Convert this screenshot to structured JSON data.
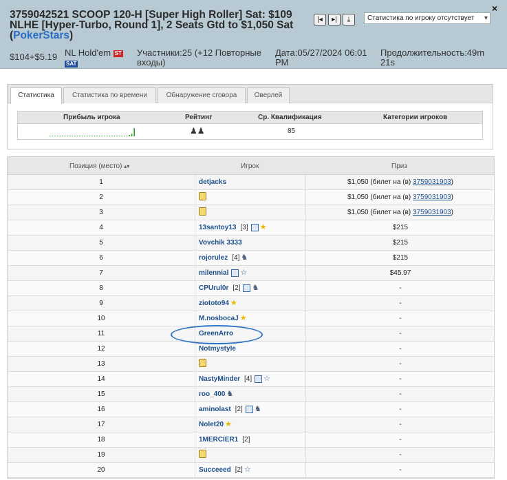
{
  "header": {
    "title_main": "3759042521 SCOOP 120-H [Super High Roller] Sat: $109 NLHE [Hyper-Turbo, Round 1], 2 Seats Gtd to $1,050 Sat (",
    "title_site": "PokerStars",
    "title_end": ")",
    "buyin": "$104+$5.19",
    "game": "NL Hold'em",
    "badge_st": "ST",
    "badge_sat": "SAT",
    "participants": "Участники:25 (+12 Повторные входы)",
    "date": "Дата:05/27/2024 06:01 PM",
    "duration": "Продолжительность:49m 21s",
    "player_stats_select": "Статистика по игроку отсутствует",
    "close": "×",
    "nav_first": "|◂",
    "nav_last": "▸|",
    "nav_download": "⤓"
  },
  "tabs": [
    "Статистика",
    "Статистика по времени",
    "Обнаружение сговора",
    "Оверлей"
  ],
  "stats": {
    "col_profit": "Прибыль игрока",
    "col_rating": "Рейтинг",
    "col_qual": "Ср. Квалификация",
    "col_categories": "Категории игроков",
    "qual_value": "85",
    "sparkline": [
      0,
      0,
      0,
      0,
      0,
      0,
      0,
      0,
      0,
      0,
      0,
      0,
      0,
      0,
      0,
      0,
      0,
      0,
      0,
      0,
      0,
      0,
      0,
      0,
      0,
      0,
      0,
      0,
      0,
      0,
      1,
      1,
      2,
      3,
      10
    ]
  },
  "table": {
    "col_position": "Позиция (место)",
    "col_player": "Игрок",
    "col_prize": "Приз",
    "ticket_prefix": "$1,050 (билет на (в) ",
    "ticket_link": "3759031903",
    "ticket_suffix": ")",
    "rows": [
      {
        "pos": "1",
        "name": "detjacks",
        "count": "",
        "icons": [],
        "prize": "ticket"
      },
      {
        "pos": "2",
        "name": "",
        "count": "",
        "icons": [
          "lock"
        ],
        "prize": "ticket"
      },
      {
        "pos": "3",
        "name": "",
        "count": "",
        "icons": [
          "lock"
        ],
        "prize": "ticket"
      },
      {
        "pos": "4",
        "name": "13santoy13",
        "count": "[3]",
        "icons": [
          "cal",
          "star"
        ],
        "prize": "$215"
      },
      {
        "pos": "5",
        "name": "Vovchik 3333",
        "count": "",
        "icons": [],
        "prize": "$215"
      },
      {
        "pos": "6",
        "name": "rojorulez",
        "count": "[4]",
        "icons": [
          "fig"
        ],
        "prize": "$215"
      },
      {
        "pos": "7",
        "name": "milennial",
        "count": "",
        "icons": [
          "cal",
          "star-o"
        ],
        "prize": "$45.97"
      },
      {
        "pos": "8",
        "name": "CPUrul0r",
        "count": "[2]",
        "icons": [
          "cal",
          "fig"
        ],
        "prize": "-"
      },
      {
        "pos": "9",
        "name": "ziototo94",
        "count": "",
        "icons": [
          "star"
        ],
        "prize": "-"
      },
      {
        "pos": "10",
        "name": "M.nosbocaJ",
        "count": "",
        "icons": [
          "star"
        ],
        "prize": "-"
      },
      {
        "pos": "11",
        "name": "GreenArro",
        "count": "",
        "icons": [],
        "prize": "-"
      },
      {
        "pos": "12",
        "name": "NotmystyIe",
        "count": "",
        "icons": [],
        "prize": "-"
      },
      {
        "pos": "13",
        "name": "",
        "count": "",
        "icons": [
          "lock"
        ],
        "prize": "-"
      },
      {
        "pos": "14",
        "name": "NastyMinder",
        "count": "[4]",
        "icons": [
          "cal",
          "star-o"
        ],
        "prize": "-"
      },
      {
        "pos": "15",
        "name": "roo_400",
        "count": "",
        "icons": [
          "fig"
        ],
        "prize": "-"
      },
      {
        "pos": "16",
        "name": "aminolast",
        "count": "[2]",
        "icons": [
          "cal",
          "fig"
        ],
        "prize": "-"
      },
      {
        "pos": "17",
        "name": "Nolet20",
        "count": "",
        "icons": [
          "star"
        ],
        "prize": "-"
      },
      {
        "pos": "18",
        "name": "1MERCIER1",
        "count": "[2]",
        "icons": [],
        "prize": "-"
      },
      {
        "pos": "19",
        "name": "",
        "count": "",
        "icons": [
          "lock"
        ],
        "prize": "-"
      },
      {
        "pos": "20",
        "name": "Succeeed",
        "count": "[2]",
        "icons": [
          "star-o"
        ],
        "prize": "-"
      }
    ]
  },
  "colors": {
    "header_bg": "#b7cad3",
    "link": "#1d4f8a",
    "annotation": "#2f74c0",
    "spark": "#2a9d2a"
  }
}
